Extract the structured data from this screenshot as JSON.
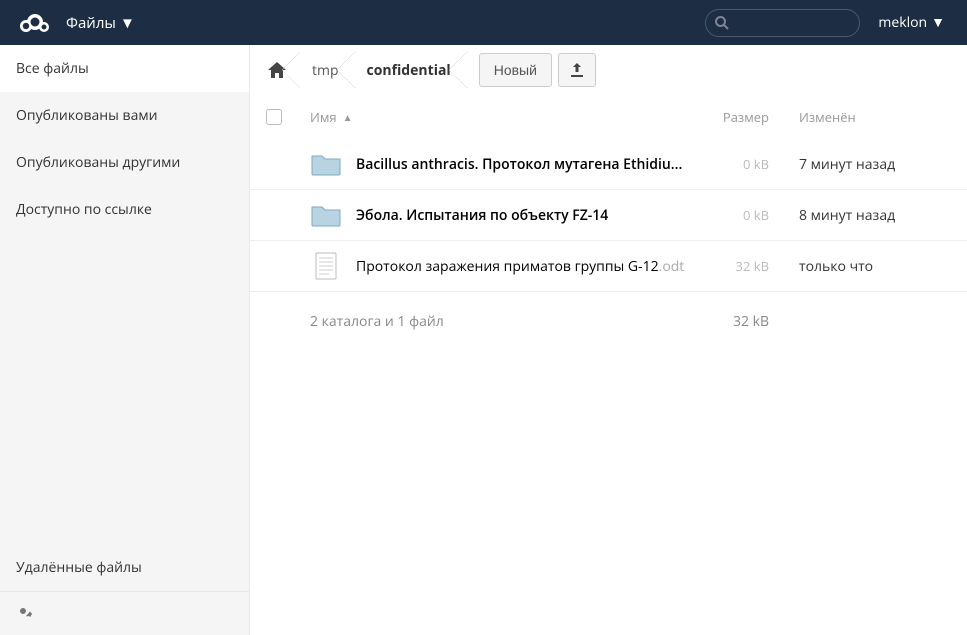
{
  "header": {
    "app_label": "Файлы",
    "username": "meklon",
    "search_placeholder": ""
  },
  "sidebar": {
    "items": [
      {
        "label": "Все файлы",
        "active": true
      },
      {
        "label": "Опубликованы вами",
        "active": false
      },
      {
        "label": "Опубликованы другими",
        "active": false
      },
      {
        "label": "Доступно по ссылке",
        "active": false
      }
    ],
    "trash_label": "Удалённые файлы"
  },
  "breadcrumb": {
    "segments": [
      {
        "label": "tmp"
      },
      {
        "label": "confidential"
      }
    ]
  },
  "controls": {
    "new_label": "Новый"
  },
  "columns": {
    "name": "Имя",
    "size": "Размер",
    "modified": "Изменён",
    "sort_indicator": "▲"
  },
  "files": [
    {
      "type": "folder",
      "name": "Bacillus anthracis. Протокол мутагена Ethidiu...",
      "ext": "",
      "size": "0 kB",
      "mtime": "7 минут назад"
    },
    {
      "type": "folder",
      "name": "Эбола. Испытания по объекту FZ-14",
      "ext": "",
      "size": "0 kB",
      "mtime": "8 минут назад"
    },
    {
      "type": "file",
      "name": "Протокол заражения приматов группы G-12",
      "ext": ".odt",
      "size": "32 kB",
      "mtime": "только что"
    }
  ],
  "summary": {
    "text": "2 каталога и 1 файл",
    "size": "32 kB"
  }
}
